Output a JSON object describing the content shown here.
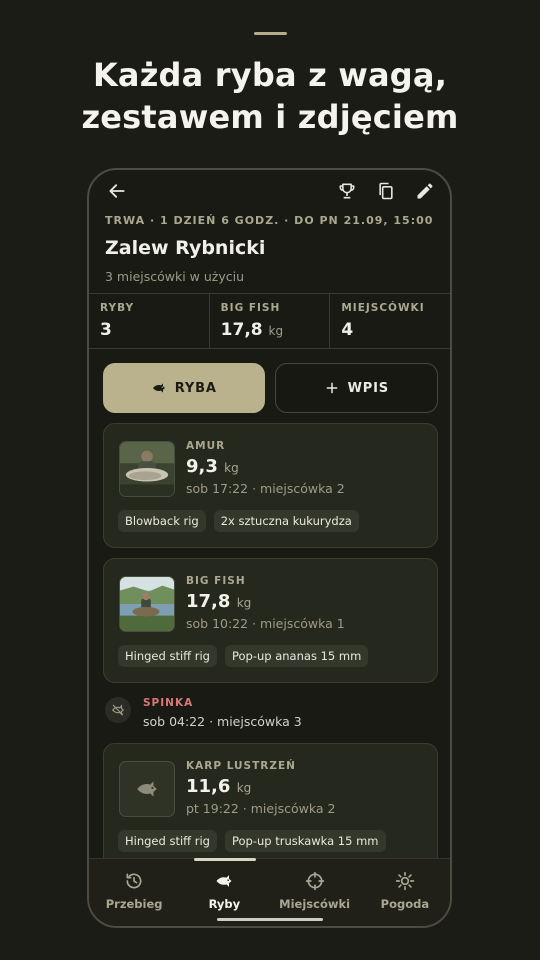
{
  "headline": {
    "line1": "Każda ryba z wagą,",
    "line2": "zestawem i zdjęciem"
  },
  "appbar": {
    "icons": [
      "arrow-back-icon",
      "trophy-icon",
      "copy-icon",
      "edit-icon"
    ]
  },
  "session": {
    "status": "TRWA · 1 DZIEŃ 6 GODZ. · DO PN 21.09, 15:00",
    "water_name": "Zalew Rybnicki",
    "spots_used": "3 miejscówki w użyciu"
  },
  "stats": [
    {
      "label": "RYBY",
      "value": "3",
      "unit": ""
    },
    {
      "label": "BIG FISH",
      "value": "17,8",
      "unit": "kg"
    },
    {
      "label": "MIEJSCÓWKI",
      "value": "4",
      "unit": ""
    }
  ],
  "actions": {
    "fish_label": "RYBA",
    "entry_label": "WPIS"
  },
  "catches": [
    {
      "species": "AMUR",
      "weight": "9,3",
      "unit": "kg",
      "meta": "sob 17:22 · miejscówka 2",
      "tags": [
        "Blowback rig",
        "2x sztuczna kukurydza"
      ]
    },
    {
      "species": "BIG FISH",
      "weight": "17,8",
      "unit": "kg",
      "meta": "sob 10:22 · miejscówka 1",
      "tags": [
        "Hinged stiff rig",
        "Pop-up ananas 15 mm"
      ]
    },
    {
      "species": "KARP LUSTRZEŃ",
      "weight": "11,6",
      "unit": "kg",
      "meta": "pt 19:22 · miejscówka 2",
      "tags": [
        "Hinged stiff rig",
        "Pop-up truskawka 15 mm"
      ]
    }
  ],
  "event": {
    "title": "SPINKA",
    "meta": "sob 04:22 · miejscówka 3",
    "color": "#d9787a"
  },
  "nav": [
    {
      "label": "Przebieg",
      "icon": "history-icon"
    },
    {
      "label": "Ryby",
      "icon": "fish-icon"
    },
    {
      "label": "Miejscówki",
      "icon": "crosshair-icon"
    },
    {
      "label": "Pogoda",
      "icon": "sun-icon"
    }
  ],
  "colors": {
    "accent": "#b9b28d",
    "background": "#1c1c17",
    "card": "#25291d",
    "event": "#d9787a"
  }
}
